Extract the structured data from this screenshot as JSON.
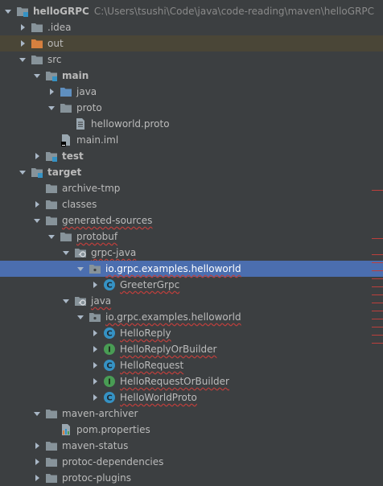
{
  "tree": [
    {
      "label": "helloGRPC",
      "bold": true,
      "path": "C:\\Users\\tsushi\\Code\\java\\code-reading\\maven\\helloGRPC",
      "depth": 0,
      "arrow": "down",
      "icon": "module-folder-icon",
      "color": "#87939a"
    },
    {
      "label": ".idea",
      "depth": 1,
      "arrow": "right",
      "icon": "folder-icon",
      "color": "#87939a"
    },
    {
      "label": "out",
      "depth": 1,
      "arrow": "right",
      "icon": "excluded-folder-icon",
      "color": "#d6803f",
      "highlight": "out"
    },
    {
      "label": "src",
      "depth": 1,
      "arrow": "down",
      "icon": "folder-icon",
      "color": "#87939a"
    },
    {
      "label": "main",
      "bold": true,
      "depth": 2,
      "arrow": "down",
      "icon": "module-folder-icon",
      "color": "#87939a"
    },
    {
      "label": "java",
      "depth": 3,
      "arrow": "right",
      "icon": "source-folder-icon",
      "color": "#5f8fbf"
    },
    {
      "label": "proto",
      "depth": 3,
      "arrow": "down",
      "icon": "folder-icon",
      "color": "#87939a"
    },
    {
      "label": "helloworld.proto",
      "depth": 4,
      "arrow": "none",
      "icon": "text-file-icon",
      "color": "#9aa7b0"
    },
    {
      "label": "main.iml",
      "depth": 3,
      "arrow": "none",
      "icon": "iml-file-icon",
      "color": "#9aa7b0"
    },
    {
      "label": "test",
      "bold": true,
      "depth": 2,
      "arrow": "right",
      "icon": "module-folder-icon",
      "color": "#87939a"
    },
    {
      "label": "target",
      "bold": true,
      "depth": 1,
      "arrow": "down",
      "icon": "module-folder-icon",
      "color": "#87939a"
    },
    {
      "label": "archive-tmp",
      "depth": 2,
      "arrow": "none",
      "icon": "folder-icon",
      "color": "#87939a"
    },
    {
      "label": "classes",
      "depth": 2,
      "arrow": "right",
      "icon": "folder-icon",
      "color": "#87939a"
    },
    {
      "label": "generated-sources",
      "depth": 2,
      "arrow": "down",
      "icon": "folder-icon",
      "color": "#87939a",
      "squiggle": true
    },
    {
      "label": "protobuf",
      "depth": 3,
      "arrow": "down",
      "icon": "folder-icon",
      "color": "#87939a",
      "squiggle": true
    },
    {
      "label": "grpc-java",
      "depth": 4,
      "arrow": "down",
      "icon": "generated-source-folder-icon",
      "color": "#87939a",
      "squiggle": true
    },
    {
      "label": "io.grpc.examples.helloworld",
      "depth": 5,
      "arrow": "down",
      "icon": "package-icon",
      "color": "#87939a",
      "selected": true,
      "squiggle": true
    },
    {
      "label": "GreeterGrpc",
      "depth": 6,
      "arrow": "right",
      "icon": "class-icon",
      "color": "#3592c4",
      "squiggle": true
    },
    {
      "label": "java",
      "depth": 4,
      "arrow": "down",
      "icon": "generated-source-folder-icon",
      "color": "#87939a",
      "squiggle": true
    },
    {
      "label": "io.grpc.examples.helloworld",
      "depth": 5,
      "arrow": "down",
      "icon": "package-icon",
      "color": "#87939a",
      "squiggle": true
    },
    {
      "label": "HelloReply",
      "depth": 6,
      "arrow": "right",
      "icon": "class-icon",
      "color": "#3592c4",
      "squiggle": true
    },
    {
      "label": "HelloReplyOrBuilder",
      "depth": 6,
      "arrow": "right",
      "icon": "interface-icon",
      "color": "#499c54",
      "squiggle": true
    },
    {
      "label": "HelloRequest",
      "depth": 6,
      "arrow": "right",
      "icon": "class-icon",
      "color": "#3592c4",
      "squiggle": true
    },
    {
      "label": "HelloRequestOrBuilder",
      "depth": 6,
      "arrow": "right",
      "icon": "interface-icon",
      "color": "#499c54",
      "squiggle": true
    },
    {
      "label": "HelloWorldProto",
      "depth": 6,
      "arrow": "right",
      "icon": "class-icon",
      "color": "#3592c4",
      "squiggle": true
    },
    {
      "label": "maven-archiver",
      "depth": 2,
      "arrow": "down",
      "icon": "folder-icon",
      "color": "#87939a"
    },
    {
      "label": "pom.properties",
      "depth": 3,
      "arrow": "none",
      "icon": "properties-file-icon",
      "color": "#9aa7b0"
    },
    {
      "label": "maven-status",
      "depth": 2,
      "arrow": "right",
      "icon": "folder-icon",
      "color": "#87939a"
    },
    {
      "label": "protoc-dependencies",
      "depth": 2,
      "arrow": "right",
      "icon": "folder-icon",
      "color": "#87939a"
    },
    {
      "label": "protoc-plugins",
      "depth": 2,
      "arrow": "right",
      "icon": "folder-icon",
      "color": "#87939a"
    }
  ]
}
